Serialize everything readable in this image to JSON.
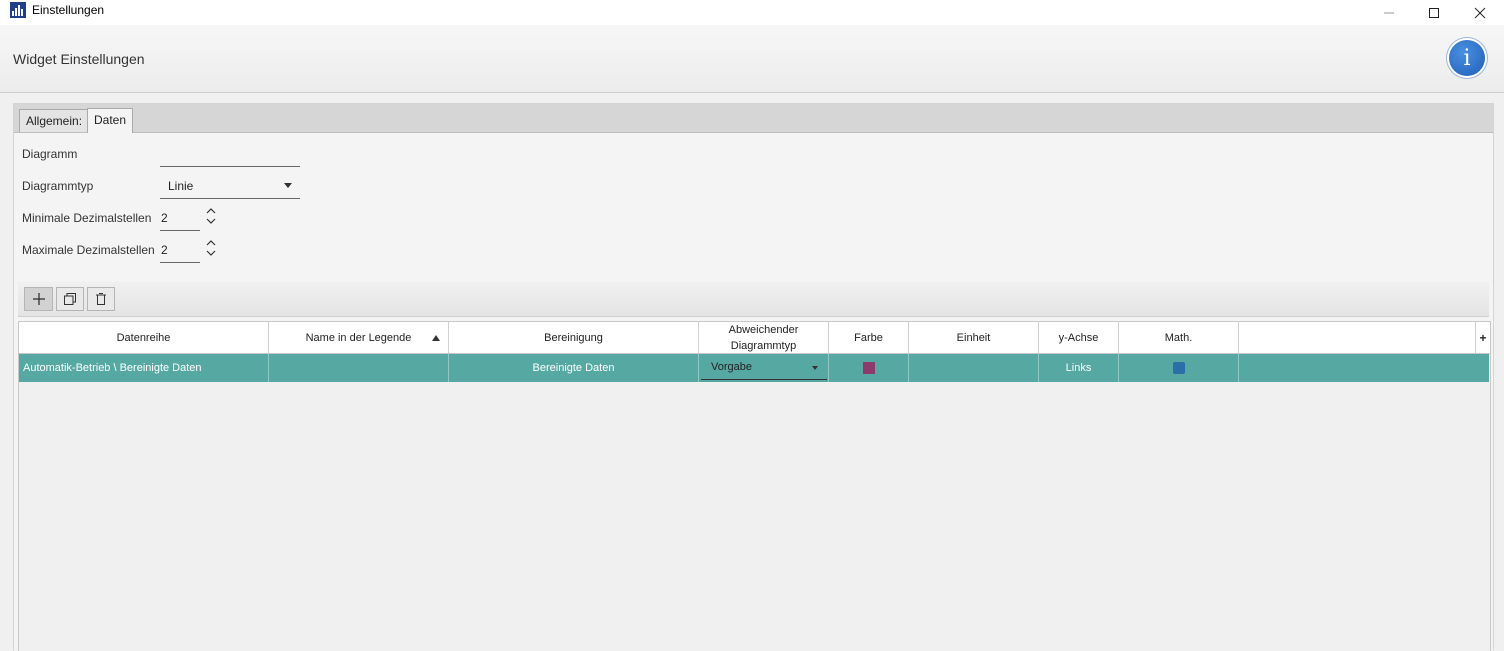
{
  "window": {
    "title": "Einstellungen"
  },
  "header": {
    "title": "Widget Einstellungen",
    "info_glyph": "i"
  },
  "tabs": [
    {
      "label": "Allgemein:"
    },
    {
      "label": "Daten"
    }
  ],
  "form": {
    "diagramm_label": "Diagramm",
    "diagramm_value": "",
    "diagrammtyp_label": "Diagrammtyp",
    "diagrammtyp_value": "Linie",
    "min_dez_label": "Minimale Dezimalstellen",
    "min_dez_value": "2",
    "max_dez_label": "Maximale Dezimalstellen",
    "max_dez_value": "2"
  },
  "table": {
    "headers": {
      "datenreihe": "Datenreihe",
      "name": "Name in der Legende",
      "bereinigung": "Bereinigung",
      "abweichend_1": "Abweichender",
      "abweichend_2": "Diagrammtyp",
      "farbe": "Farbe",
      "einheit": "Einheit",
      "yachse": "y-Achse",
      "math": "Math."
    },
    "add_column_glyph": "+",
    "row": {
      "datenreihe": "Automatik-Betrieb \\ Bereinigte Daten",
      "name": "",
      "bereinigung": "Bereinigte Daten",
      "diagrammtyp": "Vorgabe",
      "farbe_color": "#8c3b6e",
      "einheit": "",
      "yachse": "Links",
      "math_color": "#2a6fa8"
    }
  },
  "colors": {
    "selection": "#56a9a3",
    "accent": "#1f5fb8"
  }
}
